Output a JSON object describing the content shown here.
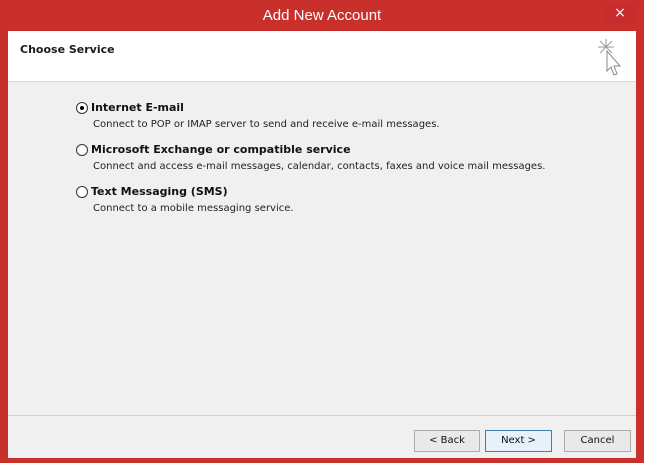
{
  "window": {
    "title": "Add New Account",
    "close_glyph": "×",
    "close_icon": "close-icon"
  },
  "header": {
    "title": "Choose Service",
    "icon": "wizard-wand-icon"
  },
  "options": [
    {
      "label": "Internet E-mail",
      "description": "Connect to POP or IMAP server to send and receive e-mail messages.",
      "selected": true
    },
    {
      "label": "Microsoft Exchange or compatible service",
      "description": "Connect and access e-mail messages, calendar, contacts, faxes and voice mail messages.",
      "selected": false
    },
    {
      "label": "Text Messaging (SMS)",
      "description": "Connect to a mobile messaging service.",
      "selected": false
    }
  ],
  "footer": {
    "back_label": "< Back",
    "next_label": "Next >",
    "cancel_label": "Cancel"
  },
  "colors": {
    "title_bar": "#c9302c",
    "dialog_bg": "#f0f0f0",
    "header_bg": "#ffffff"
  }
}
